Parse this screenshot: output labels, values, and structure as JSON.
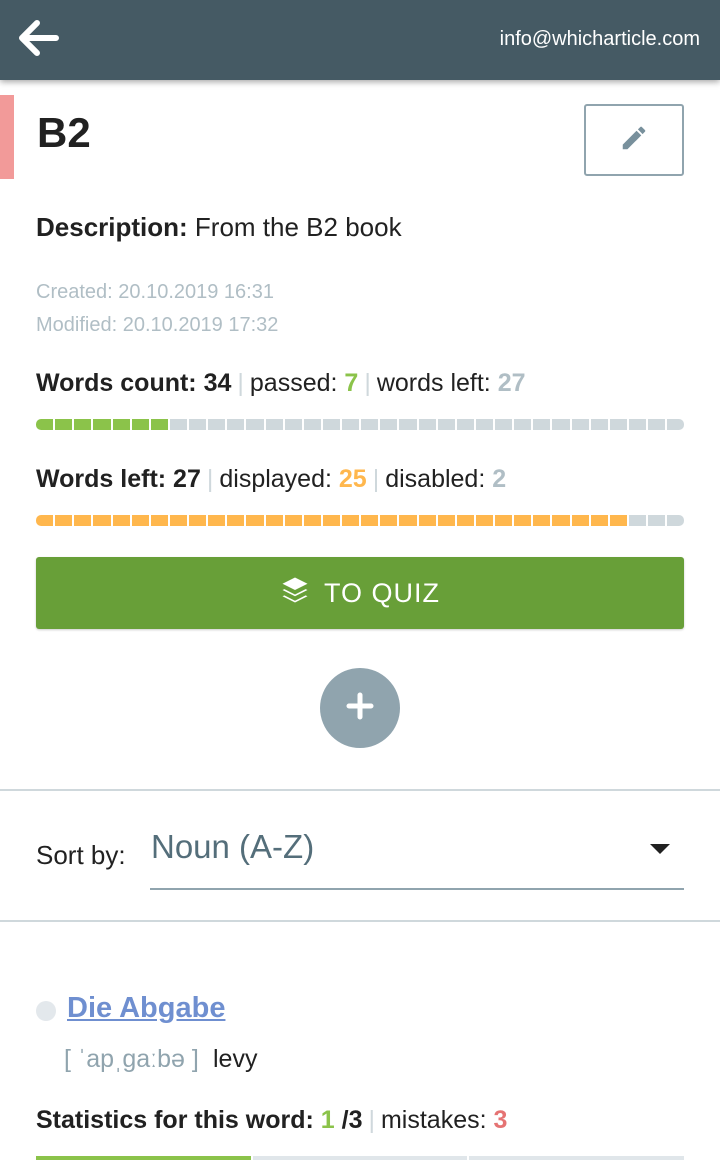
{
  "header": {
    "email": "info@whicharticle.com"
  },
  "set": {
    "title": "B2",
    "accent_color": "#f29a99",
    "description_label": "Description:",
    "description_value": "From the B2 book",
    "created": "Created: 20.10.2019 16:31",
    "modified": "Modified: 20.10.2019 17:32"
  },
  "progress": {
    "words_count_label": "Words count:",
    "words_count": "34",
    "passed_label": "passed:",
    "passed": "7",
    "words_left_label": "words left:",
    "words_left": "27",
    "passed_fraction": 0.206
  },
  "display": {
    "words_left_label": "Words left:",
    "words_left": "27",
    "displayed_label": "displayed:",
    "displayed": "25",
    "disabled_label": "disabled:",
    "disabled": "2",
    "displayed_fraction": 0.926
  },
  "colors": {
    "green": "#8bc34a",
    "orange": "#ffb74d",
    "grey": "#b0bec5",
    "red": "#e57373",
    "track": "#cfd8dc"
  },
  "actions": {
    "quiz_label": "TO QUIZ"
  },
  "sort": {
    "label": "Sort by:",
    "value": "Noun (A-Z)"
  },
  "word": {
    "title": "Die Abgabe",
    "phonetic": "[ ˈapˌɡaːbə ]",
    "translation": "levy",
    "stats_label": "Statistics for this word:",
    "correct": "1",
    "total": "/3",
    "mistakes_label": "mistakes:",
    "mistakes": "3"
  }
}
